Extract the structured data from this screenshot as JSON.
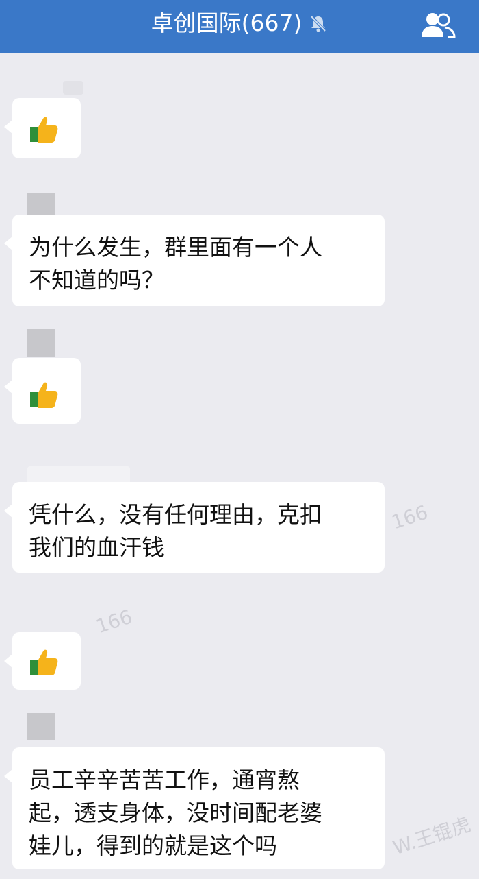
{
  "header": {
    "title": "卓创国际(667)",
    "mute_icon": "mute-bell-icon",
    "members_icon": "group-members-icon"
  },
  "messages": [
    {
      "type": "emoji",
      "emoji": "thumbs-up"
    },
    {
      "type": "text",
      "text": "为什么发生，群里面有一个人\n不知道的吗？"
    },
    {
      "type": "emoji",
      "emoji": "thumbs-up"
    },
    {
      "type": "text",
      "text": "凭什么，没有任何理由，克扣\n我们的血汗钱"
    },
    {
      "type": "emoji",
      "emoji": "thumbs-up"
    },
    {
      "type": "text",
      "text": "员工辛辛苦苦工作，通宵熬\n起，透支身体，没时间配老婆\n娃儿，得到的就是这个吗"
    }
  ],
  "watermarks": [
    "166",
    "166",
    "W.王锟虎"
  ]
}
